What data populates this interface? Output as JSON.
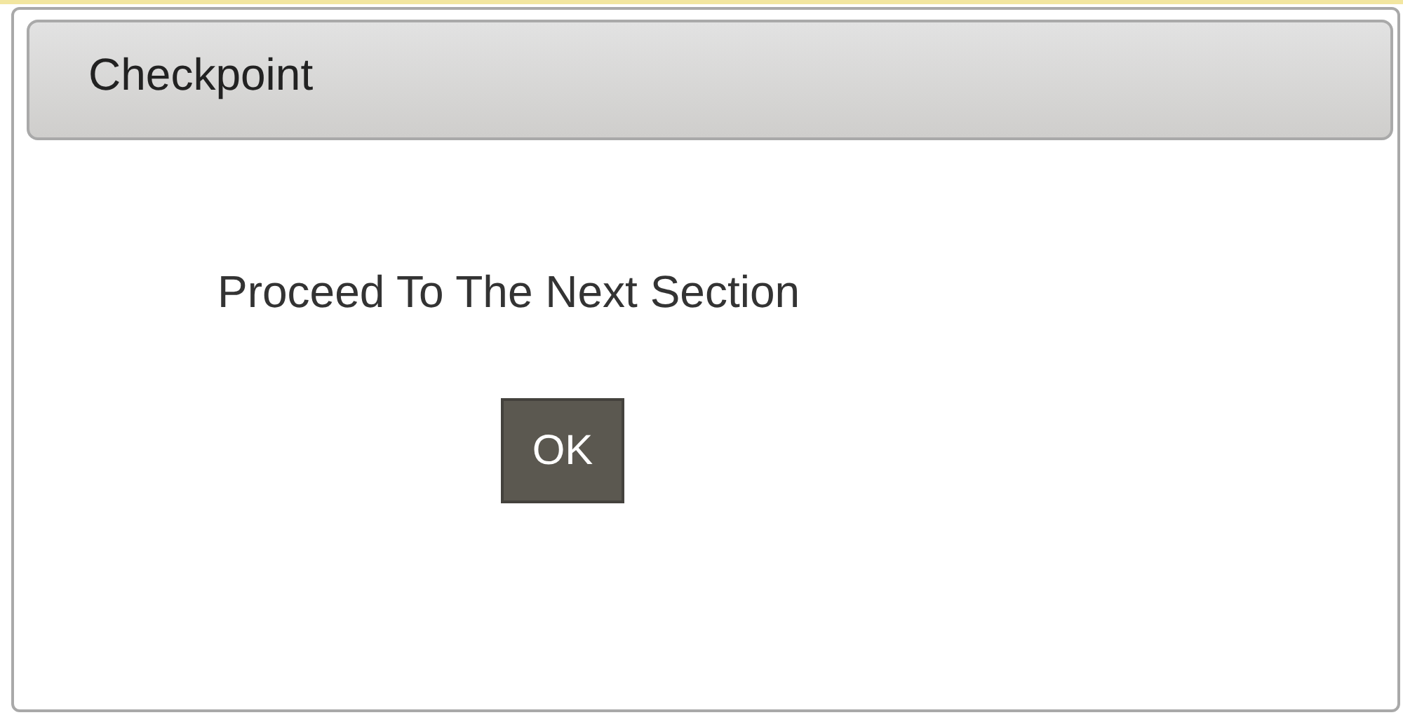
{
  "dialog": {
    "title": "Checkpoint",
    "message": "Proceed To The Next Section",
    "buttons": [
      "OK"
    ]
  }
}
